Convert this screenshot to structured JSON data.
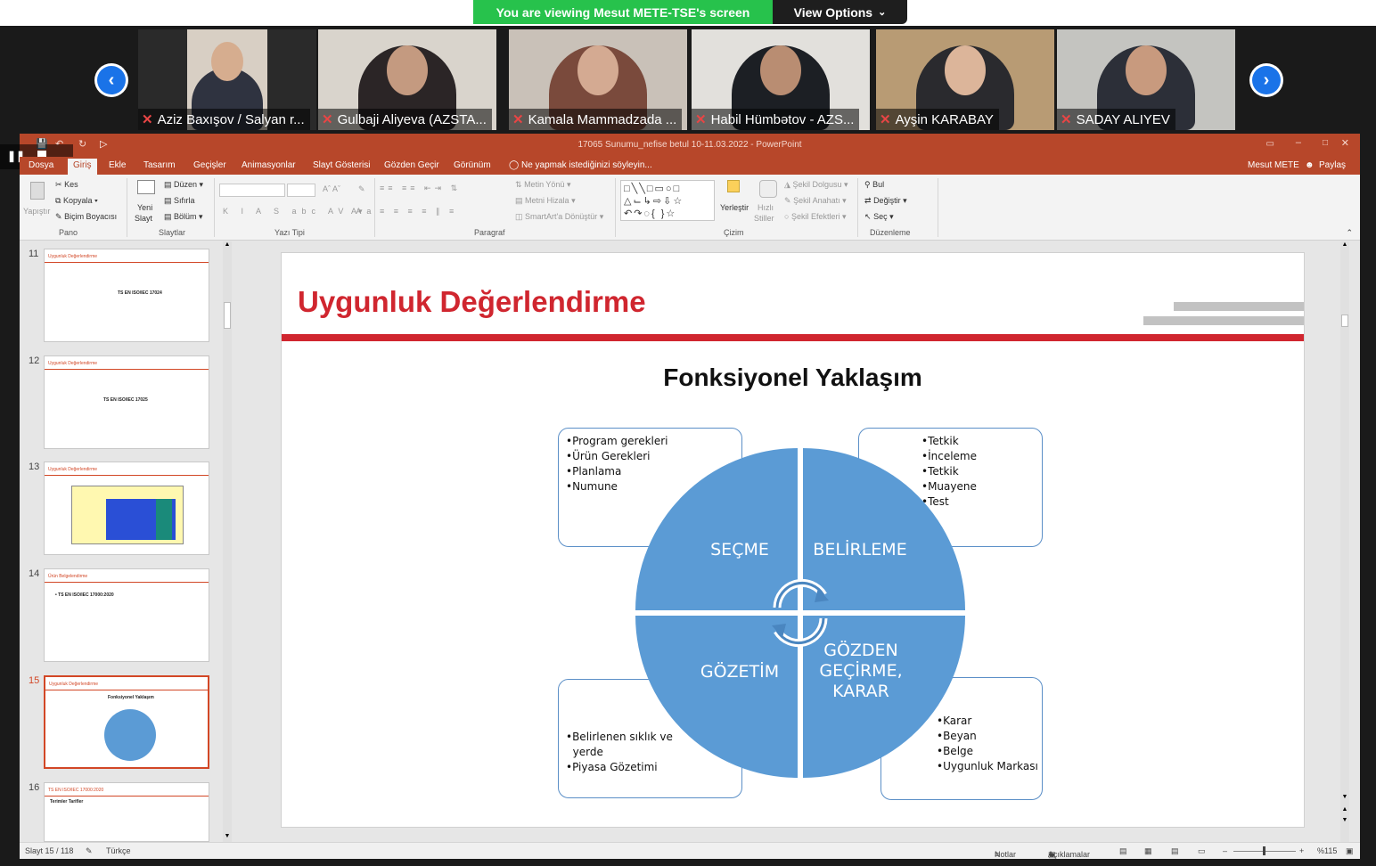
{
  "zoom": {
    "banner_text": "You are viewing Mesut METE-TSE's screen",
    "view_options": "View Options",
    "participants": [
      {
        "name": "Aziz Baxışov / Salyan r..."
      },
      {
        "name": "Gulbaji Aliyeva (AZSTA..."
      },
      {
        "name": "Kamala Mammadzada ..."
      },
      {
        "name": "Habil Hümbətov - AZS..."
      },
      {
        "name": "Ayşin KARABAY"
      },
      {
        "name": "SADAY ALIYEV"
      }
    ]
  },
  "ppt": {
    "window_title": "17065 Sunumu_nefise betul 10-11.03.2022 - PowerPoint",
    "quick_tab": "Dosya",
    "tabs": [
      "Giriş",
      "Ekle",
      "Tasarım",
      "Geçişler",
      "Animasyonlar",
      "Slayt Gösterisi",
      "Gözden Geçir",
      "Görünüm"
    ],
    "tell_me": "Ne yapmak istediğinizi söyleyin...",
    "user": "Mesut METE",
    "share": "Paylaş",
    "ribbon": {
      "pano": {
        "paste": "Yapıştır",
        "cut": "Kes",
        "copy": "Kopyala",
        "format_painter": "Biçim Boyacısı",
        "label": "Pano"
      },
      "slaytlar": {
        "new_slide": "Yeni",
        "new_slide2": "Slayt",
        "layout": "Düzen",
        "reset": "Sıfırla",
        "section": "Bölüm",
        "label": "Slaytlar"
      },
      "yazi_tipi": {
        "label": "Yazı Tipi"
      },
      "paragraf": {
        "text_direction": "Metin Yönü",
        "align_text": "Metni Hizala",
        "smartart": "SmartArt'a Dönüştür",
        "label": "Paragraf"
      },
      "cizim": {
        "arrange": "Yerleştir",
        "quick_styles": "Hızlı",
        "quick_styles2": "Stiller",
        "fill": "Şekil Dolgusu",
        "outline": "Şekil Anahatı",
        "effects": "Şekil Efektleri",
        "label": "Çizim"
      },
      "duzenleme": {
        "find": "Bul",
        "replace": "Değiştir",
        "select": "Seç",
        "label": "Düzenleme"
      }
    },
    "thumbnails": [
      {
        "num": "11",
        "header": "Uygunluk Değerlendirme",
        "text": "TS EN ISO/IEC 17024"
      },
      {
        "num": "12",
        "header": "Uygunluk Değerlendirme",
        "text": "TS EN ISO/IEC 17025"
      },
      {
        "num": "13",
        "header": "Uygunluk Değerlendirme",
        "text": ""
      },
      {
        "num": "14",
        "header": "Ürün Belgelendirme",
        "text": "• TS EN ISO/IEC 17000:2020"
      },
      {
        "num": "15",
        "header": "Uygunluk Değerlendirme",
        "text": "Fonksiyonel Yaklaşım"
      },
      {
        "num": "16",
        "header": "TS EN ISO/IEC 17000:2020",
        "text": "Terimler Tarifler"
      }
    ],
    "slide": {
      "title": "Uygunluk Değerlendirme",
      "subtitle": "Fonksiyonel Yaklaşım",
      "box_top_left": [
        "•Program gerekleri",
        "•Ürün Gerekleri",
        "•Planlama",
        "•Numune"
      ],
      "box_top_right": [
        "•Tetkik",
        "•İnceleme",
        "•Tetkik",
        "•Muayene",
        "•Test"
      ],
      "box_bottom_left": [
        "•Belirlenen sıklık ve",
        "  yerde",
        "•Piyasa Gözetimi"
      ],
      "box_bottom_right": [
        "•Karar",
        "•Beyan",
        "•Belge",
        "•Uygunluk Markası"
      ],
      "quad_tl": "SEÇME",
      "quad_tr": "BELİRLEME",
      "quad_bl": "GÖZETİM",
      "quad_br": "GÖZDEN\nGEÇİRME,\nKARAR",
      "circle_color": "#5b9bd5"
    },
    "status": {
      "slide": "Slayt 15 / 118",
      "language": "Türkçe",
      "notes": "Notlar",
      "comments": "Açıklamalar",
      "zoom": "%115"
    }
  }
}
